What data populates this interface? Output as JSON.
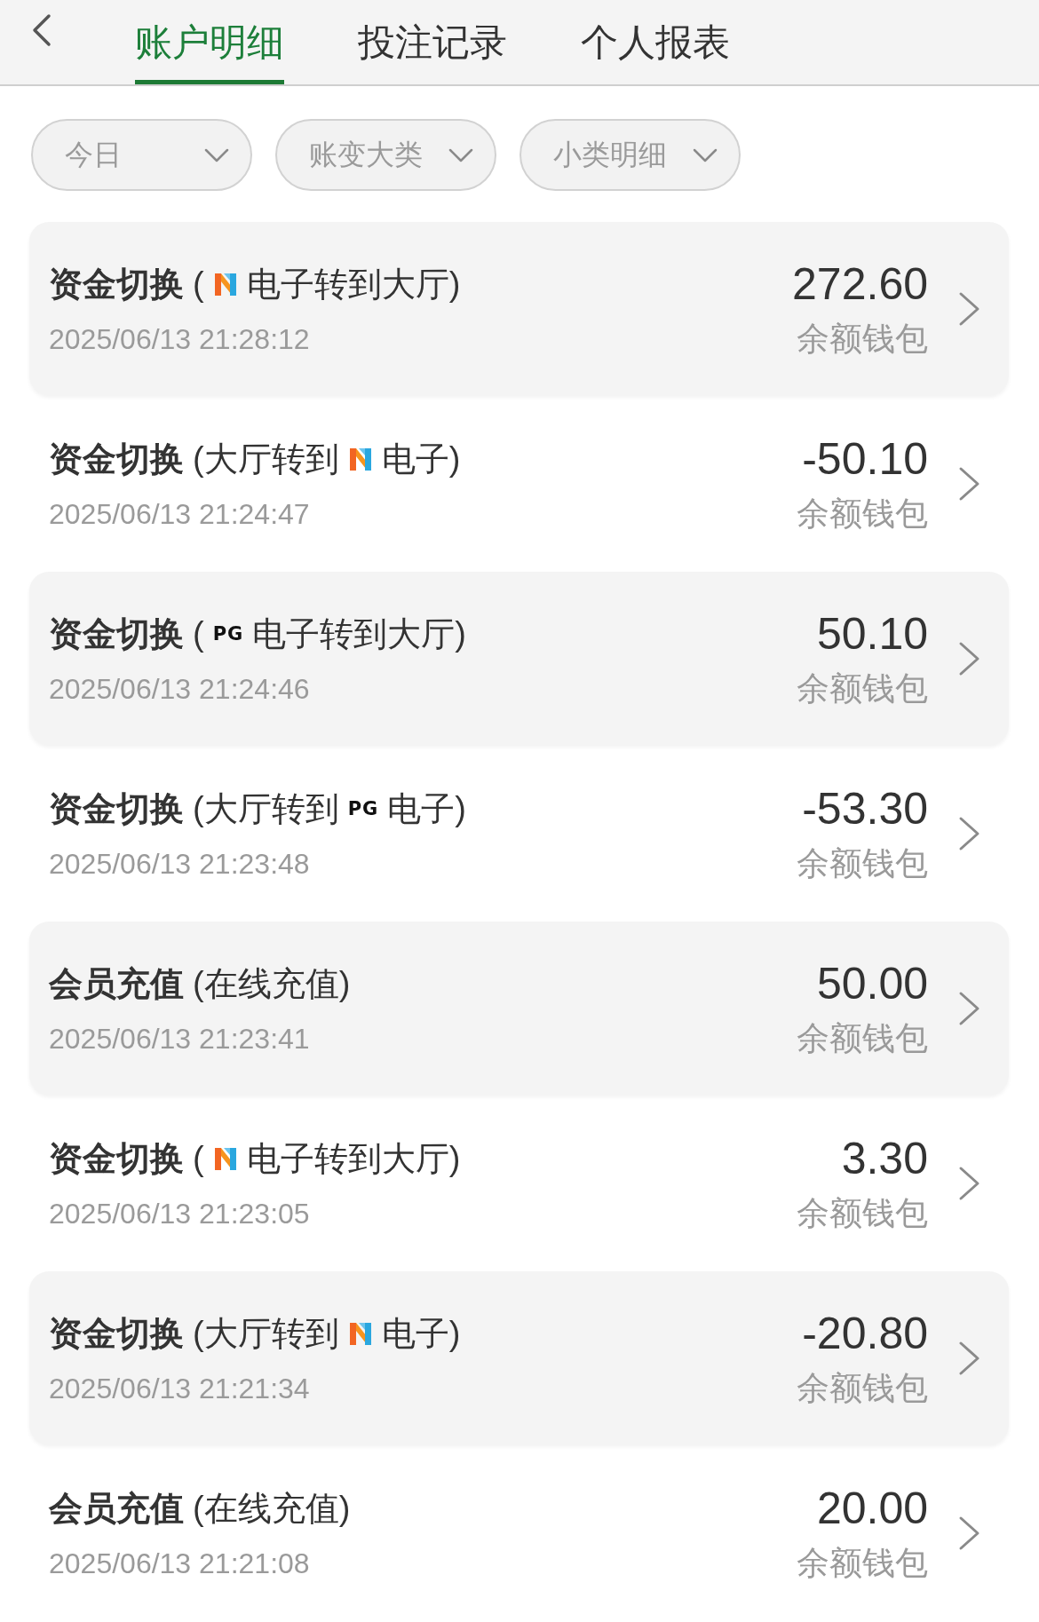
{
  "tabs": [
    {
      "label": "账户明细",
      "selected": true
    },
    {
      "label": "投注记录",
      "selected": false
    },
    {
      "label": "个人报表",
      "selected": false
    }
  ],
  "filters": [
    "今日",
    "账变大类",
    "小类明细"
  ],
  "records": [
    {
      "category": "资金切换",
      "detail": [
        {
          "kind": "text",
          "text": "("
        },
        {
          "kind": "m_logo"
        },
        {
          "kind": "text",
          "text": "电子转到大厅)"
        }
      ],
      "time": "2025/06/13 21:28:12",
      "amount": "272.60",
      "wallet": "余额钱包"
    },
    {
      "category": "资金切换",
      "detail": [
        {
          "kind": "text",
          "text": "(大厅转到"
        },
        {
          "kind": "m_logo"
        },
        {
          "kind": "text",
          "text": "电子)"
        }
      ],
      "time": "2025/06/13 21:24:47",
      "amount": "-50.10",
      "wallet": "余额钱包"
    },
    {
      "category": "资金切换",
      "detail": [
        {
          "kind": "text",
          "text": "("
        },
        {
          "kind": "pg_logo",
          "text": "PG"
        },
        {
          "kind": "text",
          "text": "电子转到大厅)"
        }
      ],
      "time": "2025/06/13 21:24:46",
      "amount": "50.10",
      "wallet": "余额钱包"
    },
    {
      "category": "资金切换",
      "detail": [
        {
          "kind": "text",
          "text": "(大厅转到"
        },
        {
          "kind": "pg_logo",
          "text": "PG"
        },
        {
          "kind": "text",
          "text": "电子)"
        }
      ],
      "time": "2025/06/13 21:23:48",
      "amount": "-53.30",
      "wallet": "余额钱包"
    },
    {
      "category": "会员充值",
      "detail": [
        {
          "kind": "text",
          "text": "(在线充值)"
        }
      ],
      "time": "2025/06/13 21:23:41",
      "amount": "50.00",
      "wallet": "余额钱包"
    },
    {
      "category": "资金切换",
      "detail": [
        {
          "kind": "text",
          "text": "("
        },
        {
          "kind": "m_logo"
        },
        {
          "kind": "text",
          "text": "电子转到大厅)"
        }
      ],
      "time": "2025/06/13 21:23:05",
      "amount": "3.30",
      "wallet": "余额钱包"
    },
    {
      "category": "资金切换",
      "detail": [
        {
          "kind": "text",
          "text": "(大厅转到"
        },
        {
          "kind": "m_logo"
        },
        {
          "kind": "text",
          "text": "电子)"
        }
      ],
      "time": "2025/06/13 21:21:34",
      "amount": "-20.80",
      "wallet": "余额钱包"
    },
    {
      "category": "会员充值",
      "detail": [
        {
          "kind": "text",
          "text": "(在线充值)"
        }
      ],
      "time": "2025/06/13 21:21:08",
      "amount": "20.00",
      "wallet": "余额钱包"
    }
  ]
}
